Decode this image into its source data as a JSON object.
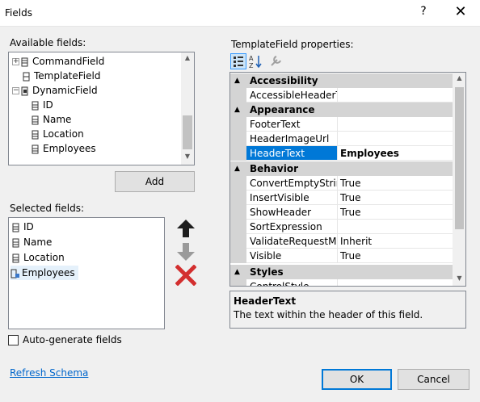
{
  "window": {
    "title": "Fields",
    "help_glyph": "?",
    "close_glyph": "✕"
  },
  "available": {
    "label": "Available fields:",
    "items": [
      {
        "label": "CommandField",
        "expander": "+"
      },
      {
        "label": "TemplateField"
      },
      {
        "label": "DynamicField",
        "expander": "−"
      },
      {
        "label": "ID"
      },
      {
        "label": "Name"
      },
      {
        "label": "Location"
      },
      {
        "label": "Employees"
      }
    ],
    "scroll_up": "▲",
    "scroll_down": "▼"
  },
  "add_button": "Add",
  "selected": {
    "label": "Selected fields:",
    "items": [
      "ID",
      "Name",
      "Location",
      "Employees"
    ],
    "selected_index": 3
  },
  "autogen": {
    "label": "Auto-generate fields",
    "checked": false
  },
  "refresh_link": "Refresh Schema",
  "properties": {
    "label": "TemplateField properties:",
    "categories": [
      {
        "name": "Accessibility",
        "glyph": "▲",
        "props": [
          {
            "name": "AccessibleHeaderText",
            "value": ""
          }
        ]
      },
      {
        "name": "Appearance",
        "glyph": "▲",
        "props": [
          {
            "name": "FooterText",
            "value": ""
          },
          {
            "name": "HeaderImageUrl",
            "value": ""
          },
          {
            "name": "HeaderText",
            "value": "Employees",
            "selected": true
          }
        ]
      },
      {
        "name": "Behavior",
        "glyph": "▲",
        "props": [
          {
            "name": "ConvertEmptyStringToNull",
            "value": "True"
          },
          {
            "name": "InsertVisible",
            "value": "True"
          },
          {
            "name": "ShowHeader",
            "value": "True"
          },
          {
            "name": "SortExpression",
            "value": ""
          },
          {
            "name": "ValidateRequestMode",
            "value": "Inherit"
          },
          {
            "name": "Visible",
            "value": "True"
          }
        ]
      },
      {
        "name": "Styles",
        "glyph": "▲",
        "props": [
          {
            "name": "ControlStyle",
            "value": ""
          }
        ]
      }
    ],
    "description_title": "HeaderText",
    "description_text": "The text within the header of this field."
  },
  "ok_button": "OK",
  "cancel_button": "Cancel",
  "colors": {
    "accent": "#0078d7",
    "category_bg": "#d4d4d4",
    "up_arrow": "#1e1e1e",
    "down_arrow": "#9a9a9a",
    "delete": "#d32f2f"
  }
}
